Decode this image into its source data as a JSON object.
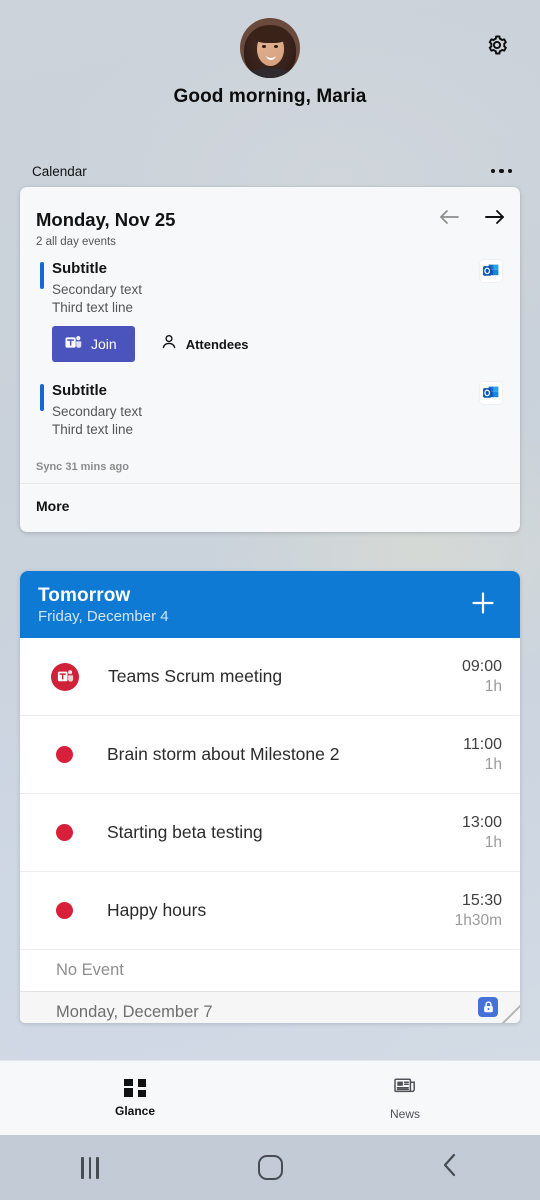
{
  "header": {
    "greeting": "Good morning, Maria",
    "gear_icon": "gear-icon",
    "avatar_icon": "user-avatar"
  },
  "calendar_widget": {
    "label": "Calendar",
    "overflow_icon": "more-horizontal-icon",
    "date_title": "Monday, Nov 25",
    "all_day_summary": "2 all day events",
    "prev_icon": "arrow-left-icon",
    "next_icon": "arrow-right-icon",
    "accent_color": "#1667d2",
    "events": [
      {
        "title": "Subtitle",
        "secondary": "Secondary text",
        "third": "Third text line",
        "source_icon": "outlook-icon",
        "join_label": "Join",
        "join_icon": "teams-icon",
        "attendees_label": "Attendees",
        "attendees_icon": "person-icon",
        "has_actions": true
      },
      {
        "title": "Subtitle",
        "secondary": "Secondary text",
        "third": "Third text line",
        "source_icon": "outlook-icon",
        "has_actions": false
      }
    ],
    "sync_status": "Sync 31 mins ago",
    "more_label": "More"
  },
  "tomorrow_widget": {
    "header_title": "Tomorrow",
    "header_subtitle": "Friday, December 4",
    "header_color": "#0f7ad4",
    "add_icon": "plus-icon",
    "dot_color": "#d8203a",
    "rows": [
      {
        "icon": "teams-icon",
        "name": "Teams Scrum meeting",
        "time": "09:00",
        "duration": "1h"
      },
      {
        "icon": "dot-icon",
        "name": "Brain storm about Milestone 2",
        "time": "11:00",
        "duration": "1h"
      },
      {
        "icon": "dot-icon",
        "name": "Starting beta testing",
        "time": "13:00",
        "duration": "1h"
      },
      {
        "icon": "dot-icon",
        "name": "Happy hours",
        "time": "15:30",
        "duration": "1h30m"
      }
    ],
    "no_event_label": "No Event",
    "next_day_label": "Monday, December 7",
    "resize_handle_icon": "resize-handle-icon",
    "resize_badge_icon": "lock-icon"
  },
  "tabbar": {
    "tabs": [
      {
        "label": "Glance",
        "icon": "glance-icon",
        "active": true
      },
      {
        "label": "News",
        "icon": "news-icon",
        "active": false
      }
    ]
  },
  "navbar": {
    "recents_icon": "recents-icon",
    "home_icon": "home-icon",
    "back_icon": "back-icon"
  }
}
